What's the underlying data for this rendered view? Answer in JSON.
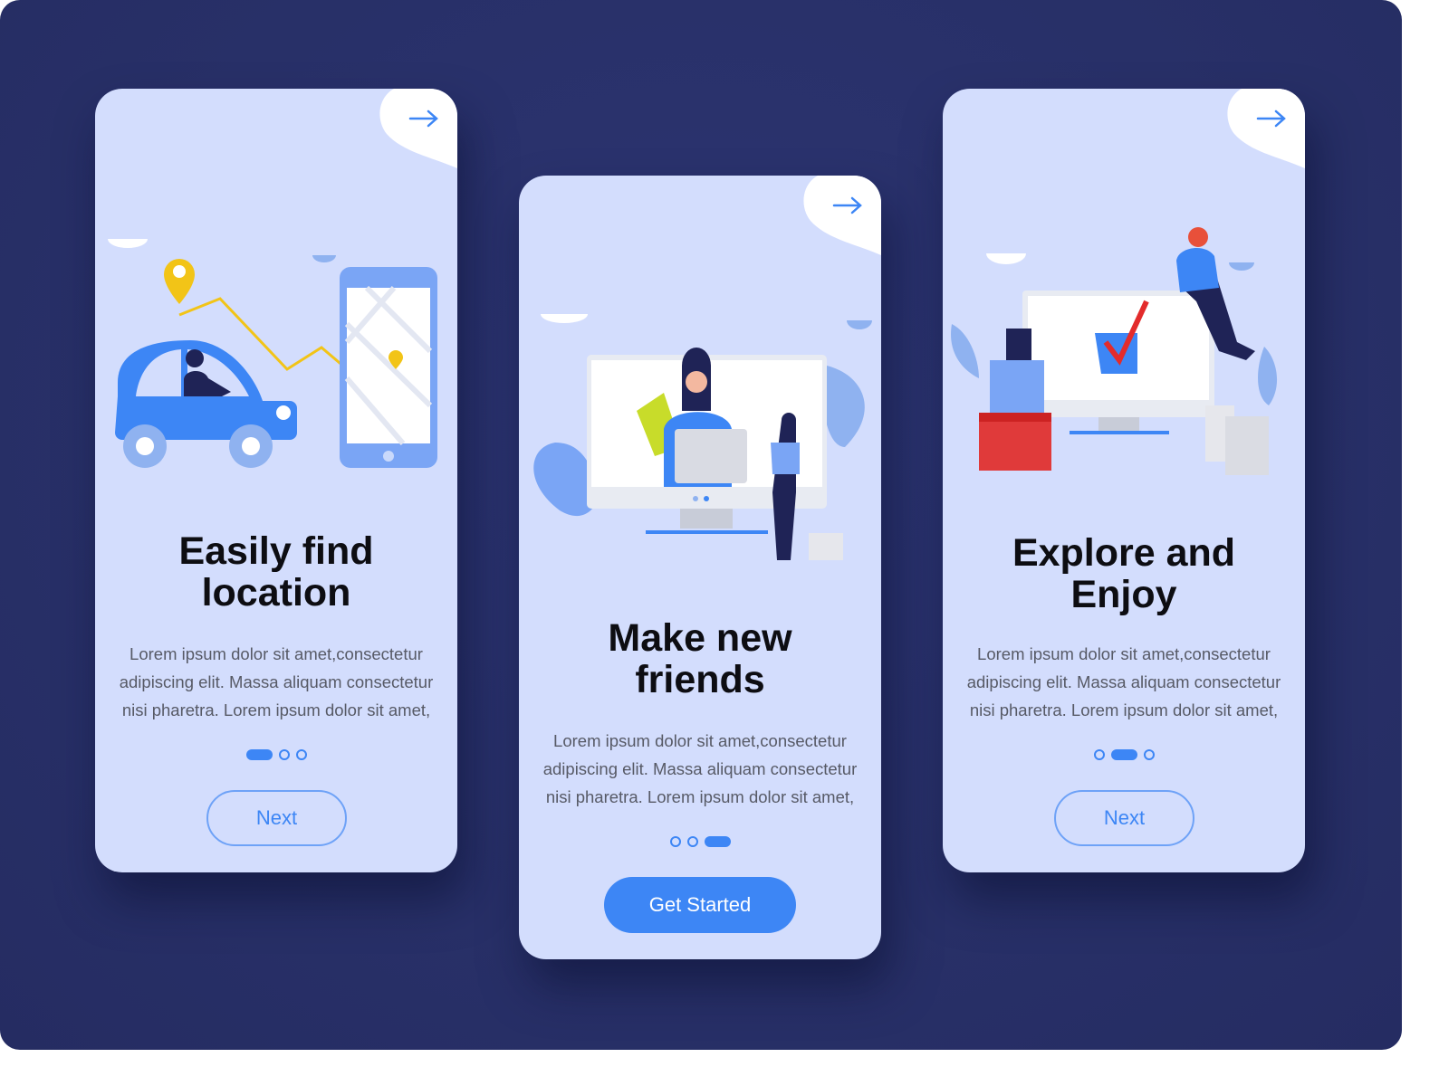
{
  "colors": {
    "background": "#283068",
    "card": "#d3ddfd",
    "accent": "#3d86f5",
    "title": "#0d0d12",
    "body_text": "#575a66"
  },
  "screens": [
    {
      "title_line1": "Easily find",
      "title_line2": "location",
      "body_lines": [
        "Lorem ipsum dolor sit amet,consectetur",
        "adipiscing elit. Massa aliquam consectetur",
        "nisi pharetra. Lorem ipsum dolor sit amet,"
      ],
      "active_dot": 1,
      "button_label": "Next",
      "illustration": "car-map-phone",
      "arrow_icon": "arrow-right-icon"
    },
    {
      "title_line1": "Make new",
      "title_line2": "friends",
      "body_lines": [
        "Lorem ipsum dolor sit amet,consectetur",
        "adipiscing elit. Massa aliquam consectetur",
        "nisi pharetra. Lorem ipsum dolor sit amet,"
      ],
      "active_dot": 3,
      "button_label": "Get Started",
      "illustration": "video-chat-monitor",
      "arrow_icon": "arrow-right-icon"
    },
    {
      "title_line1": "Explore and",
      "title_line2": "Enjoy",
      "body_lines": [
        "Lorem ipsum dolor sit amet,consectetur",
        "adipiscing elit. Massa aliquam consectetur",
        "nisi pharetra. Lorem ipsum dolor sit amet,"
      ],
      "active_dot": 2,
      "button_label": "Next",
      "illustration": "shopping-monitor-checkmark",
      "arrow_icon": "arrow-right-icon"
    }
  ]
}
